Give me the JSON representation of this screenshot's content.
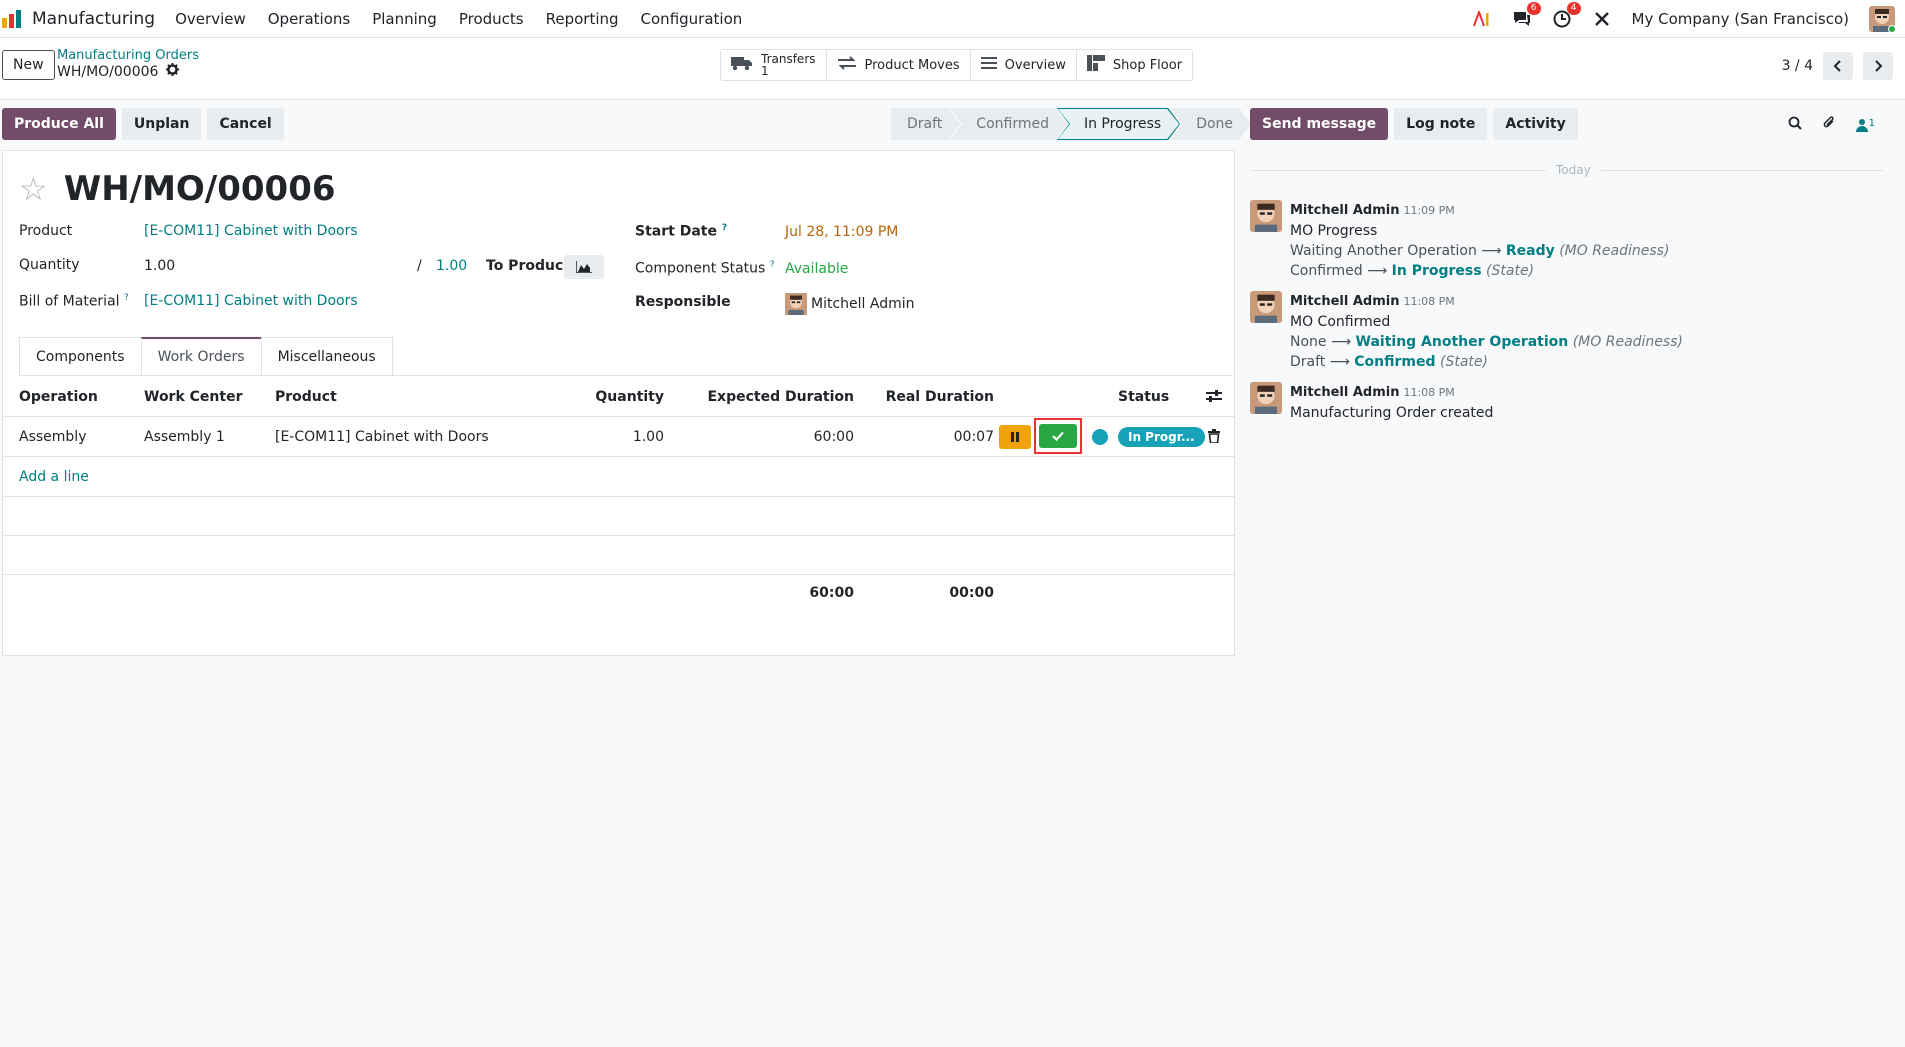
{
  "navbar": {
    "app_name": "Manufacturing",
    "menu": [
      "Overview",
      "Operations",
      "Planning",
      "Products",
      "Reporting",
      "Configuration"
    ],
    "messages_badge": "6",
    "activities_badge": "4",
    "company": "My Company (San Francisco)"
  },
  "control": {
    "new_label": "New",
    "breadcrumb_parent": "Manufacturing Orders",
    "breadcrumb_current": "WH/MO/00006",
    "smart_buttons": {
      "transfers_label": "Transfers",
      "transfers_count": "1",
      "product_moves": "Product Moves",
      "overview": "Overview",
      "shop_floor": "Shop Floor"
    },
    "pager": "3 / 4"
  },
  "actions": {
    "produce_all": "Produce All",
    "unplan": "Unplan",
    "cancel": "Cancel"
  },
  "status_stages": [
    "Draft",
    "Confirmed",
    "In Progress",
    "Done"
  ],
  "form": {
    "title": "WH/MO/00006",
    "product_label": "Product",
    "product_value": "[E-COM11] Cabinet with Doors",
    "quantity_label": "Quantity",
    "quantity_value": "1.00",
    "quantity_slash": "/",
    "quantity_total": "1.00",
    "to_produce_label": "To Produce",
    "bom_label": "Bill of Material",
    "bom_value": "[E-COM11] Cabinet with Doors",
    "start_date_label": "Start Date",
    "start_date_value": "Jul 28, 11:09 PM",
    "component_status_label": "Component Status",
    "component_status_value": "Available",
    "responsible_label": "Responsible",
    "responsible_value": "Mitchell Admin",
    "help_mark": "?"
  },
  "tabs": [
    "Components",
    "Work Orders",
    "Miscellaneous"
  ],
  "work_orders": {
    "headers": {
      "operation": "Operation",
      "work_center": "Work Center",
      "product": "Product",
      "quantity": "Quantity",
      "expected_duration": "Expected Duration",
      "real_duration": "Real Duration",
      "status": "Status"
    },
    "rows": [
      {
        "operation": "Assembly",
        "work_center": "Assembly 1",
        "product": "[E-COM11] Cabinet with Doors",
        "quantity": "1.00",
        "expected_duration": "60:00",
        "real_duration": "00:07",
        "status": "In Progr..."
      }
    ],
    "add_line": "Add a line",
    "total_expected": "60:00",
    "total_real": "00:00"
  },
  "chatter": {
    "send_message": "Send message",
    "log_note": "Log note",
    "activity": "Activity",
    "followers_count": "1",
    "day_label": "Today",
    "messages": [
      {
        "author": "Mitchell Admin",
        "time": "11:09 PM",
        "body": "MO Progress",
        "tracks": [
          {
            "old": "Waiting Another Operation",
            "new": "Ready",
            "field": "(MO Readiness)"
          },
          {
            "old": "Confirmed",
            "new": "In Progress",
            "field": "(State)"
          }
        ]
      },
      {
        "author": "Mitchell Admin",
        "time": "11:08 PM",
        "body": "MO Confirmed",
        "tracks": [
          {
            "old": "None",
            "new": "Waiting Another Operation",
            "field": "(MO Readiness)"
          },
          {
            "old": "Draft",
            "new": "Confirmed",
            "field": "(State)"
          }
        ]
      },
      {
        "author": "Mitchell Admin",
        "time": "11:08 PM",
        "body": "Manufacturing Order created",
        "tracks": []
      }
    ],
    "arrow": "⟶"
  },
  "colors": {
    "brand": "#714b67",
    "link": "#017e84",
    "warning": "#f0a30a",
    "success": "#28a745",
    "info": "#17a2b8",
    "highlight": "#e8322f"
  }
}
